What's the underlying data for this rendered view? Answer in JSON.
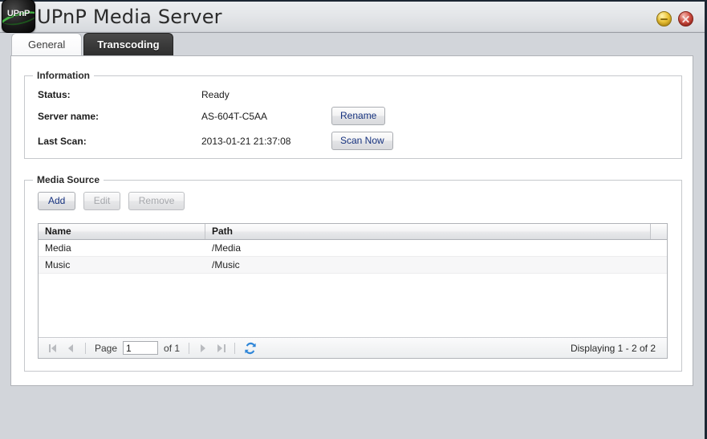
{
  "window": {
    "title": "UPnP Media Server",
    "icon_label": "UPnP",
    "icon_name": "upnp-app-icon",
    "minimize_label": "Minimize",
    "close_label": "Close"
  },
  "tabs": [
    {
      "label": "General",
      "active": true
    },
    {
      "label": "Transcoding",
      "active": false
    }
  ],
  "information": {
    "legend": "Information",
    "rows": [
      {
        "label": "Status:",
        "value": "Ready",
        "action": null
      },
      {
        "label": "Server name:",
        "value": "AS-604T-C5AA",
        "action": "Rename"
      },
      {
        "label": "Last Scan:",
        "value": "2013-01-21 21:37:08",
        "action": "Scan Now"
      }
    ]
  },
  "media_source": {
    "legend": "Media Source",
    "toolbar": [
      {
        "label": "Add",
        "enabled": true
      },
      {
        "label": "Edit",
        "enabled": false
      },
      {
        "label": "Remove",
        "enabled": false
      }
    ],
    "grid": {
      "columns": [
        "Name",
        "Path"
      ],
      "rows": [
        {
          "name": "Media",
          "path": "/Media"
        },
        {
          "name": "Music",
          "path": "/Music"
        }
      ]
    },
    "pager": {
      "page_label": "Page",
      "page_value": "1",
      "of_label": "of 1",
      "status": "Displaying 1 - 2 of 2",
      "first_title": "First Page",
      "prev_title": "Previous Page",
      "next_title": "Next Page",
      "last_title": "Last Page",
      "refresh_title": "Refresh"
    }
  },
  "colors": {
    "accent_button_text": "#15317e",
    "desktop_background": "#d2d5da",
    "active_tab_background": "#ffffff",
    "inactive_tab_background": "#3b3b3b",
    "close_button": "#d4554a",
    "minimize_button": "#ecc53a",
    "refresh_icon": "#1f72c8"
  }
}
